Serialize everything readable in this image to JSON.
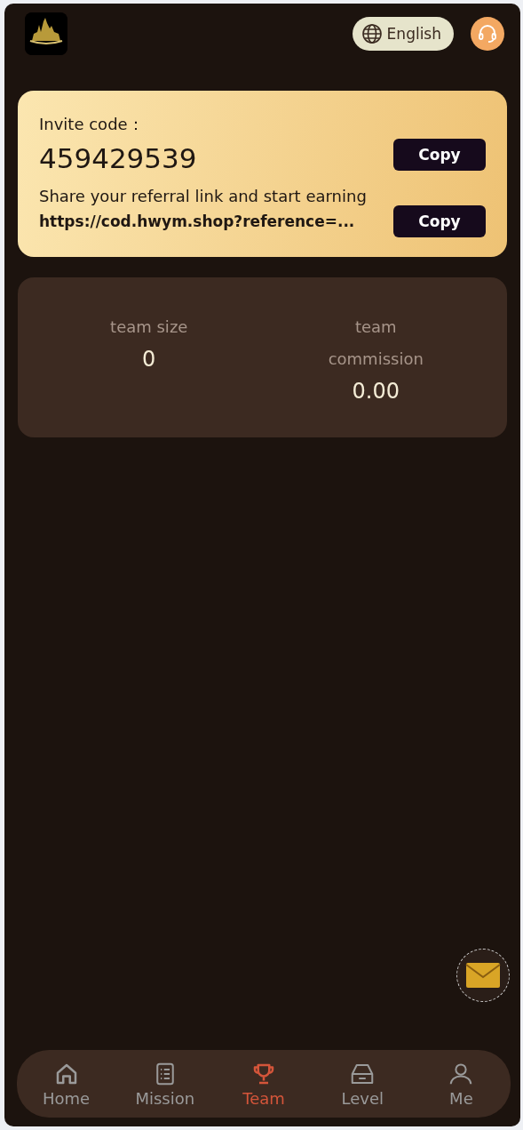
{
  "header": {
    "language": "English"
  },
  "invite": {
    "label": "Invite code：",
    "code": "459429539",
    "copy_label": "Copy",
    "share_text": "Share your referral link and start earning",
    "link": "https://cod.hwym.shop?reference=...",
    "link_copy_label": "Copy"
  },
  "stats": [
    {
      "label": "team size",
      "value": "0"
    },
    {
      "label": "team commission",
      "value": "0.00"
    }
  ],
  "nav": [
    {
      "kind": "home",
      "label": "Home",
      "selected": false
    },
    {
      "kind": "mission",
      "label": "Mission",
      "selected": false
    },
    {
      "kind": "team",
      "label": "Team",
      "selected": true
    },
    {
      "kind": "level",
      "label": "Level",
      "selected": false
    },
    {
      "kind": "me",
      "label": "Me",
      "selected": false
    }
  ]
}
